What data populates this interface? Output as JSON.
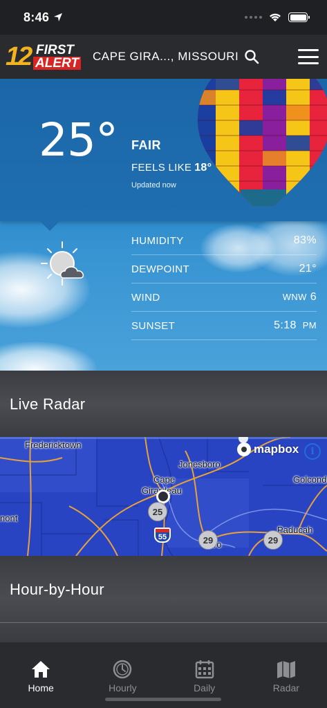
{
  "status_bar": {
    "time": "8:46"
  },
  "header": {
    "logo_number": "12",
    "logo_first": "FIRST",
    "logo_alert": "ALERT",
    "location": "CAPE GIRA..., MISSOURI"
  },
  "current": {
    "temperature": "25°",
    "condition": "FAIR",
    "feels_like_label": "FEELS LIKE",
    "feels_like_value": "18°",
    "updated": "Updated now",
    "icon": "partly-cloudy-icon"
  },
  "details": [
    {
      "label": "HUMIDITY",
      "value": "83%",
      "unit": ""
    },
    {
      "label": "DEWPOINT",
      "value": "21°",
      "unit": ""
    },
    {
      "label": "WIND",
      "value": "6",
      "unit": "WNW"
    },
    {
      "label": "SUNSET",
      "value": "5:18",
      "unit": "PM"
    }
  ],
  "radar": {
    "title": "Live Radar",
    "mapbox": "mapbox",
    "labels": [
      "Fredericktown",
      "Jonesboro",
      "Cape",
      "Girardeau",
      "Golconda",
      "nont",
      "Paducah",
      "iro"
    ],
    "routes": [
      "25",
      "55",
      "29",
      "29"
    ]
  },
  "hourly": {
    "title": "Hour-by-Hour"
  },
  "tabs": [
    {
      "label": "Home",
      "icon": "home-icon",
      "active": true
    },
    {
      "label": "Hourly",
      "icon": "clock-icon",
      "active": false
    },
    {
      "label": "Daily",
      "icon": "calendar-icon",
      "active": false
    },
    {
      "label": "Radar",
      "icon": "map-icon",
      "active": false
    }
  ],
  "colors": {
    "hero_blue": "#1f6fb0",
    "radar_blue": "#2944c2",
    "alert_red": "#d92424",
    "logo_gold": "#f2b320"
  }
}
